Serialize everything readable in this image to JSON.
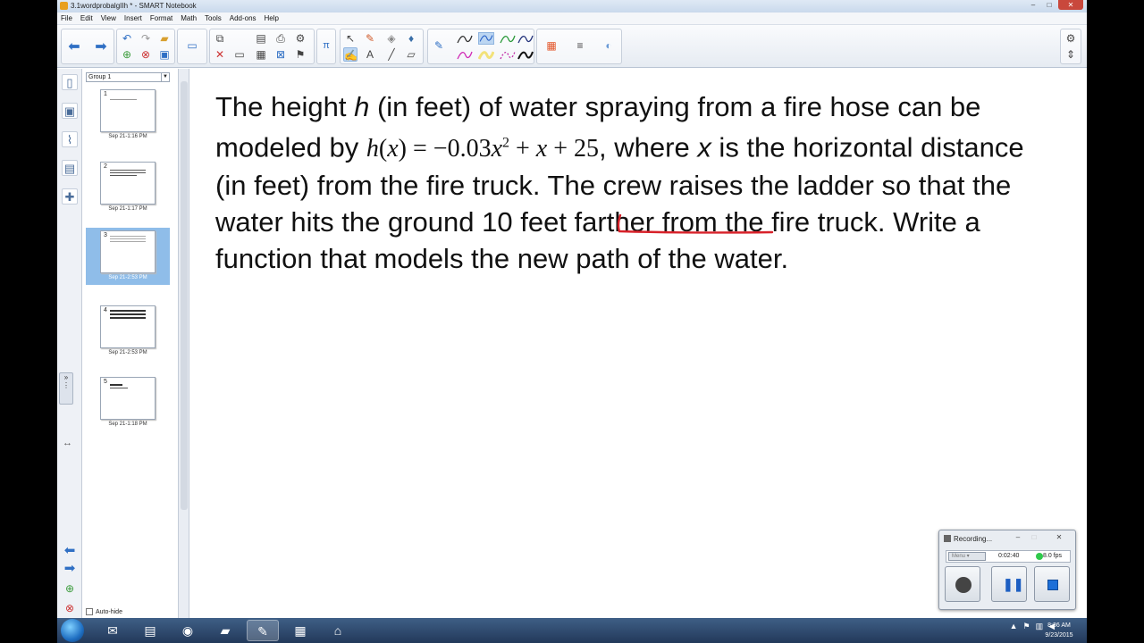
{
  "window": {
    "title": "3.1wordprobalgIIh * - SMART Notebook",
    "minimize": "–",
    "maximize": "□",
    "close": "✕"
  },
  "menu": [
    "File",
    "Edit",
    "View",
    "Insert",
    "Format",
    "Math",
    "Tools",
    "Add-ons",
    "Help"
  ],
  "sorter": {
    "group": "Group 1",
    "pages": [
      {
        "num": "1",
        "date": "Sep 21-1:16 PM",
        "selected": false
      },
      {
        "num": "2",
        "date": "Sep 21-1:17 PM",
        "selected": false
      },
      {
        "num": "3",
        "date": "Sep 21-2:53 PM",
        "selected": true
      },
      {
        "num": "4",
        "date": "Sep 21-2:53 PM",
        "selected": false
      },
      {
        "num": "5",
        "date": "Sep 21-1:18 PM",
        "selected": false
      }
    ],
    "autohide_label": "Auto-hide"
  },
  "problem": {
    "part1": "The height ",
    "var_h": "h",
    "part2": " (in feet) of water spraying from a fire hose can be modeled by ",
    "formula": "h(x) = −0.03x² + x + 25",
    "part3": ", where ",
    "var_x": "x",
    "part4": " is the horizontal distance (in feet) from the fire truck. The crew raises the ladder so that the water hits the ground ",
    "highlight": "10 feet farther",
    "part5": " from the fire truck. Write a function that models the new path of the water."
  },
  "recorder": {
    "title": "Recording...",
    "menu_label": "Menu",
    "time": "0:02:40",
    "fps": "8.0 fps",
    "status_color": "#2fc94b"
  },
  "taskbar": {
    "time": "8:36 AM",
    "date": "9/23/2015"
  }
}
